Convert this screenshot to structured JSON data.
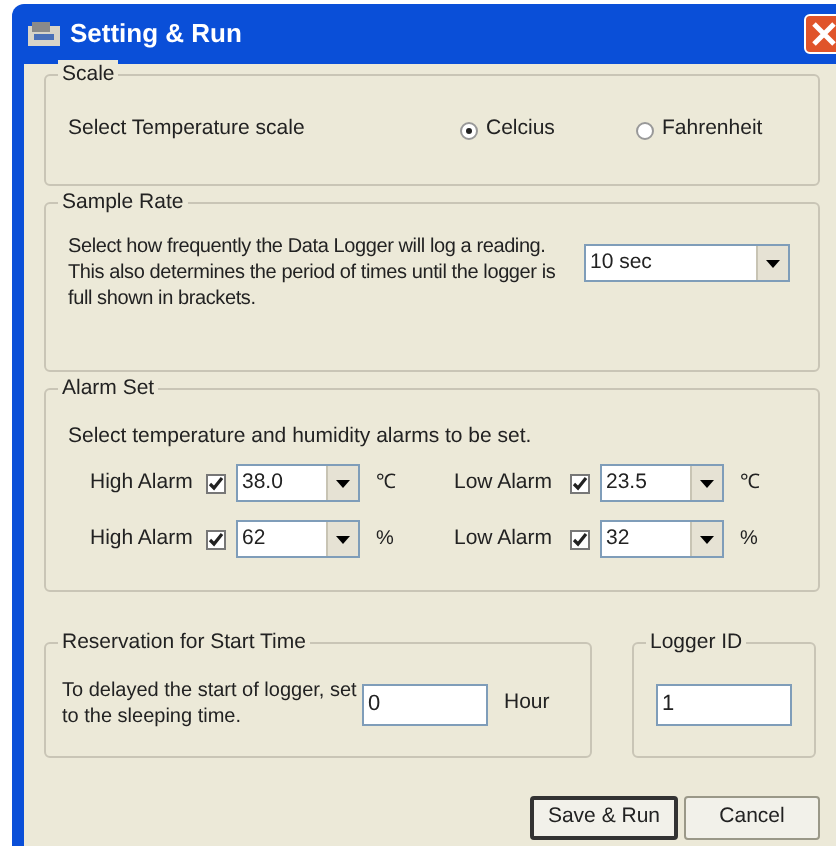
{
  "window": {
    "title": "Setting & Run"
  },
  "scale": {
    "label": "Scale",
    "prompt": "Select Temperature scale",
    "options": [
      {
        "label": "Celcius",
        "selected": true
      },
      {
        "label": "Fahrenheit",
        "selected": false
      }
    ]
  },
  "sample_rate": {
    "label": "Sample Rate",
    "description": "Select how frequently the Data Logger will log a reading. This also determines the period of times until the logger is full shown in brackets.",
    "value": "10 sec"
  },
  "alarm_set": {
    "label": "Alarm Set",
    "prompt": "Select temperature and humidity alarms to be set.",
    "alarms": [
      {
        "label": "High Alarm",
        "checked": true,
        "value": "38.0",
        "unit": "℃"
      },
      {
        "label": "Low Alarm",
        "checked": true,
        "value": "23.5",
        "unit": "℃"
      },
      {
        "label": "High Alarm",
        "checked": true,
        "value": "62",
        "unit": "%"
      },
      {
        "label": "Low Alarm",
        "checked": true,
        "value": "32",
        "unit": "%"
      }
    ]
  },
  "reservation": {
    "label": "Reservation for Start Time",
    "description": "To delayed the start of logger, set to the sleeping time.",
    "value": "0",
    "unit": "Hour"
  },
  "logger_id": {
    "label": "Logger ID",
    "value": "1"
  },
  "buttons": [
    {
      "label": "Save & Run",
      "default": true
    },
    {
      "label": "Cancel",
      "default": false
    }
  ]
}
